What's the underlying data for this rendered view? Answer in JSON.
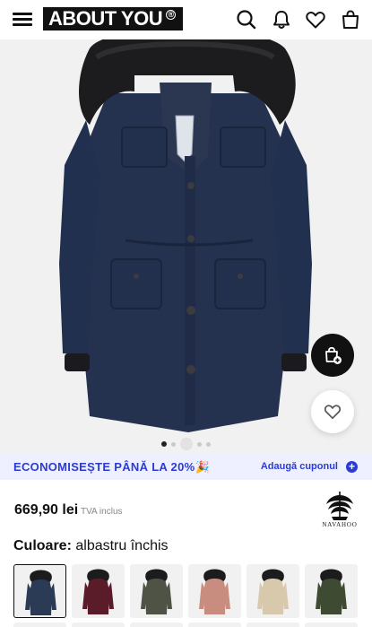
{
  "header": {
    "brand": "ABOUT YOU",
    "brand_mark": "®",
    "icons": [
      "menu-icon",
      "search-icon",
      "bell-icon",
      "heart-icon",
      "shopping-bag-icon"
    ]
  },
  "gallery": {
    "image_alt": "Navahoo winter parka with fur hood",
    "slide_count": 5,
    "active_slide": 1
  },
  "promo": {
    "text": "ECONOMISEȘTE PÂNĂ LA 20%🎉",
    "link": "Adaugă cuponul",
    "plus": "+"
  },
  "product": {
    "price": "669,90 lei",
    "vat": "TVA inclus",
    "brand": "NAVAHOO",
    "color_label": "Culoare:",
    "color_value": "albastru închis"
  },
  "swatches": [
    {
      "color": "#2b3a55",
      "selected": true
    },
    {
      "color": "#5b1c2a",
      "selected": false
    },
    {
      "color": "#4f5346",
      "selected": false
    },
    {
      "color": "#c98d80",
      "selected": false
    },
    {
      "color": "#d8c9ad",
      "selected": false
    },
    {
      "color": "#3f4a32",
      "selected": false
    }
  ],
  "colors": {
    "accent": "#2a3bd6",
    "promo_bg": "#eef0ff",
    "jacket": "#25324f",
    "fur": "#1c1c1e"
  }
}
